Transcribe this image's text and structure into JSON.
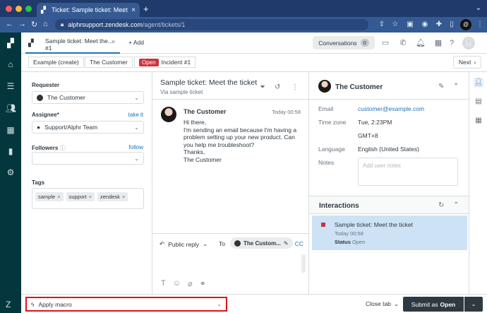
{
  "browser": {
    "tab_title": "Ticket: Sample ticket: Meet the",
    "tab_close": "×",
    "new_tab": "+",
    "url_host": "alphrsupport.zendesk.com",
    "url_path": "/agent/tickets/1",
    "profile_initial": "@"
  },
  "leftnav": {
    "icons": [
      "zendesk-logo-icon",
      "home-icon",
      "views-icon",
      "customers-icon",
      "organizations-icon",
      "reporting-icon",
      "admin-icon"
    ]
  },
  "header": {
    "ticket_tab_line1": "Sample ticket: Meet the...",
    "ticket_tab_line2": "#1",
    "add_label": "Add",
    "conversations_label": "Conversations",
    "conversations_count": "0"
  },
  "breadcrumbs": {
    "items": [
      "Example (create)",
      "The Customer"
    ],
    "status": "Open",
    "incident": "Incident #1",
    "next_label": "Next"
  },
  "properties": {
    "requester_label": "Requester",
    "requester_value": "The Customer",
    "assignee_label": "Assignee*",
    "take_it": "take it",
    "assignee_value": "Support/Alphr Team",
    "followers_label": "Followers",
    "follow_link": "follow",
    "tags_label": "Tags",
    "tags": [
      "sample",
      "support",
      "zendesk"
    ]
  },
  "conversation": {
    "title": "Sample ticket: Meet the ticket",
    "subtitle": "Via sample ticket",
    "author": "The Customer",
    "time": "Today 00:58",
    "body_lines": [
      "Hi there,",
      "I'm sending an email because I'm having a",
      "problem setting up your new product. Can",
      "you help me troubleshoot?",
      "Thanks,",
      "The Customer"
    ],
    "reply_type": "Public reply",
    "to_label": "To",
    "to_value": "The Custom...",
    "cc_label": "CC"
  },
  "customer": {
    "name": "The Customer",
    "email_label": "Email",
    "email_value": "customer@example.com",
    "timezone_label": "Time zone",
    "timezone_value": "Tue, 2:23PM",
    "timezone_offset": "GMT+8",
    "language_label": "Language",
    "language_value": "English (United States)",
    "notes_label": "Notes",
    "notes_placeholder": "Add user notes",
    "interactions_title": "Interactions",
    "interaction": {
      "title": "Sample ticket: Meet the ticket",
      "time": "Today 00:58",
      "status_label": "Status",
      "status_value": "Open"
    }
  },
  "bottom": {
    "macro_label": "Apply macro",
    "close_tab": "Close tab",
    "submit_prefix": "Submit as",
    "submit_status": "Open"
  },
  "colors": {
    "zendesk_nav": "#03363d",
    "browser_frame": "#355a93",
    "open_badge": "#cc3340",
    "link_blue": "#1f73b7",
    "highlight_red": "#e0131c"
  }
}
